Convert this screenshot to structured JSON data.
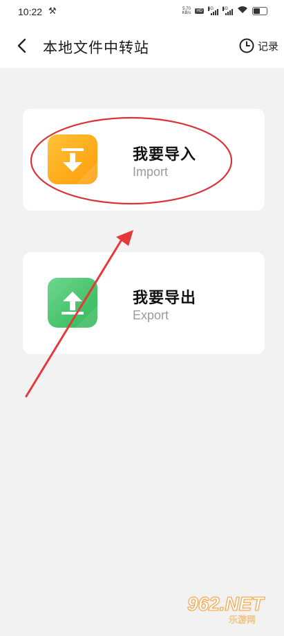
{
  "status_bar": {
    "time": "10:22",
    "net_speed_value": "5.70",
    "net_speed_unit": "KB/s",
    "hd_badge": "HD",
    "sim1_label": "5G",
    "sim2_label": "5G",
    "icons": [
      "tool-icon",
      "wifi-icon",
      "battery-icon"
    ]
  },
  "header": {
    "title": "本地文件中转站",
    "records_label": "记录",
    "icons": [
      "back-chevron-icon",
      "clock-icon"
    ]
  },
  "cards": [
    {
      "title": "我要导入",
      "subtitle": "Import",
      "icon": "import-arrow-icon",
      "color": "#ffb020"
    },
    {
      "title": "我要导出",
      "subtitle": "Export",
      "icon": "export-arrow-icon",
      "color": "#4cc572"
    }
  ],
  "annotation": {
    "ellipse_color": "#d9343a",
    "arrow_color": "#e5383b"
  },
  "watermark": {
    "logo": "962.NET",
    "sub": "乐游网"
  }
}
